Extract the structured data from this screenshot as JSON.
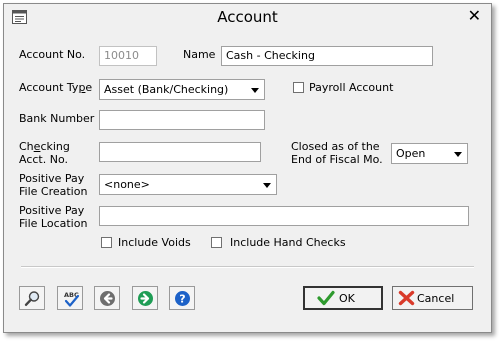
{
  "window": {
    "title": "Account",
    "close_glyph": "✕"
  },
  "form": {
    "account_no_label": "Account No.",
    "account_no_value": "10010",
    "name_label": "Name",
    "name_value": "Cash - Checking",
    "account_type_label_pre": "Account Ty",
    "account_type_label_ul": "p",
    "account_type_label_post": "e",
    "account_type_value": "Asset (Bank/Checking)",
    "payroll_account_label": "Payroll Account",
    "payroll_account_checked": false,
    "bank_number_label": "Bank Number",
    "bank_number_value": "",
    "checking_label_1_pre": "Ch",
    "checking_label_1_ul": "e",
    "checking_label_1_post": "cking",
    "checking_label_2": "Acct. No.",
    "checking_value": "",
    "closed_label_1": "Closed as of the",
    "closed_label_2": "End of Fiscal Mo.",
    "closed_value": "Open",
    "ppfc_label_1": "Positive Pay",
    "ppfc_label_2": "File Creation",
    "ppfc_value": "<none>",
    "ppfl_label_1": "Positive Pay",
    "ppfl_label_2": "File Location",
    "ppfl_value": "",
    "include_voids_label": "Include Voids",
    "include_voids_checked": false,
    "include_hand_checks_label": "Include Hand Checks",
    "include_hand_checks_checked": false
  },
  "toolbar": {
    "icons": [
      "magnifier-icon",
      "spell-check-icon",
      "back-arrow-icon",
      "forward-arrow-icon",
      "help-icon"
    ],
    "spell_text": "ABC",
    "help_glyph": "?"
  },
  "buttons": {
    "ok_label": "OK",
    "cancel_label": "Cancel"
  },
  "colors": {
    "dialog_bg": "#f0f0f0",
    "ok_check": "#2e9a2e",
    "cancel_x": "#d93a2a",
    "nav_back": "#6e6e6e",
    "nav_forward": "#1f9d55",
    "help_blue": "#1d62c8"
  }
}
